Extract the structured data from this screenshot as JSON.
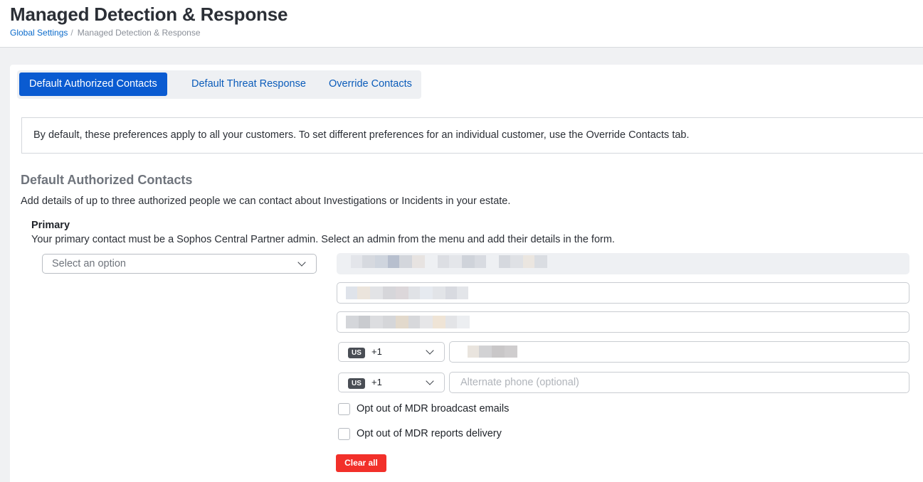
{
  "page": {
    "title": "Managed Detection & Response",
    "breadcrumb": {
      "link": "Global Settings",
      "separator": "/",
      "current": "Managed Detection & Response"
    }
  },
  "tabs": [
    {
      "label": "Default Authorized Contacts",
      "active": true
    },
    {
      "label": "Default Threat Response",
      "active": false
    },
    {
      "label": "Override Contacts",
      "active": false
    }
  ],
  "info": "By default, these preferences apply to all your customers. To set different preferences for an individual customer, use the Override Contacts tab.",
  "section": {
    "title": "Default Authorized Contacts",
    "description": "Add details of up to three authorized people we can contact about Investigations or Incidents in your estate."
  },
  "primary": {
    "label": "Primary",
    "description": "Your primary contact must be a Sophos Central Partner admin. Select an admin from the menu and add their details in the form.",
    "select_placeholder": "Select an option",
    "phone_country": "US",
    "phone_code": "+1",
    "alt_phone_country": "US",
    "alt_phone_code": "+1",
    "alt_phone_placeholder": "Alternate phone (optional)",
    "opt_out_broadcast": "Opt out of MDR broadcast emails",
    "opt_out_reports": "Opt out of MDR reports delivery",
    "clear_label": "Clear all"
  },
  "colors": {
    "accent": "#0a5bd1",
    "danger": "#f2302a",
    "link": "#0b6bcb"
  }
}
